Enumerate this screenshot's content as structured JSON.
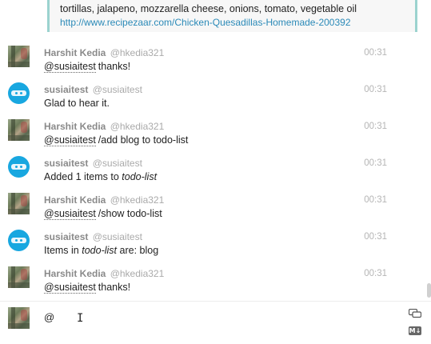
{
  "top_card": {
    "text": "tortillas, jalapeno, mozzarella cheese, onions, tomato, vegetable oil",
    "link": "http://www.recipezaar.com/Chicken-Quesadillas-Homemade-200392"
  },
  "messages": [
    {
      "avatar": "person-photo",
      "name": "Harshit Kedia",
      "handle": "@hkedia321",
      "time": "00:31",
      "mention": "@susiaitest",
      "text": "thanks!"
    },
    {
      "avatar": "bot-logo",
      "name": "susiaitest",
      "handle": "@susiaitest",
      "time": "00:31",
      "text": "Glad to hear it."
    },
    {
      "avatar": "person-photo",
      "name": "Harshit Kedia",
      "handle": "@hkedia321",
      "time": "00:31",
      "mention": "@susiaitest",
      "text": "/add blog to todo-list"
    },
    {
      "avatar": "bot-logo",
      "name": "susiaitest",
      "handle": "@susiaitest",
      "time": "00:31",
      "text_pre": "Added 1 items to ",
      "text_em": "todo-list"
    },
    {
      "avatar": "person-photo",
      "name": "Harshit Kedia",
      "handle": "@hkedia321",
      "time": "00:31",
      "mention": "@susiaitest",
      "text": "/show todo-list"
    },
    {
      "avatar": "bot-logo",
      "name": "susiaitest",
      "handle": "@susiaitest",
      "time": "00:31",
      "text_pre": "Items in ",
      "text_em": "todo-list",
      "text_post": " are: blog"
    },
    {
      "avatar": "person-photo",
      "name": "Harshit Kedia",
      "handle": "@hkedia321",
      "time": "00:31",
      "mention": "@susiaitest",
      "text": "thanks!"
    }
  ],
  "composer": {
    "value": "@",
    "icons": [
      "chat-bubbles-icon",
      "markdown-icon"
    ],
    "markdown_label": "M↓"
  },
  "colors": {
    "accent_border": "#9bd3cf",
    "link": "#2b8ab8",
    "bot_avatar": "#18a7e0"
  }
}
